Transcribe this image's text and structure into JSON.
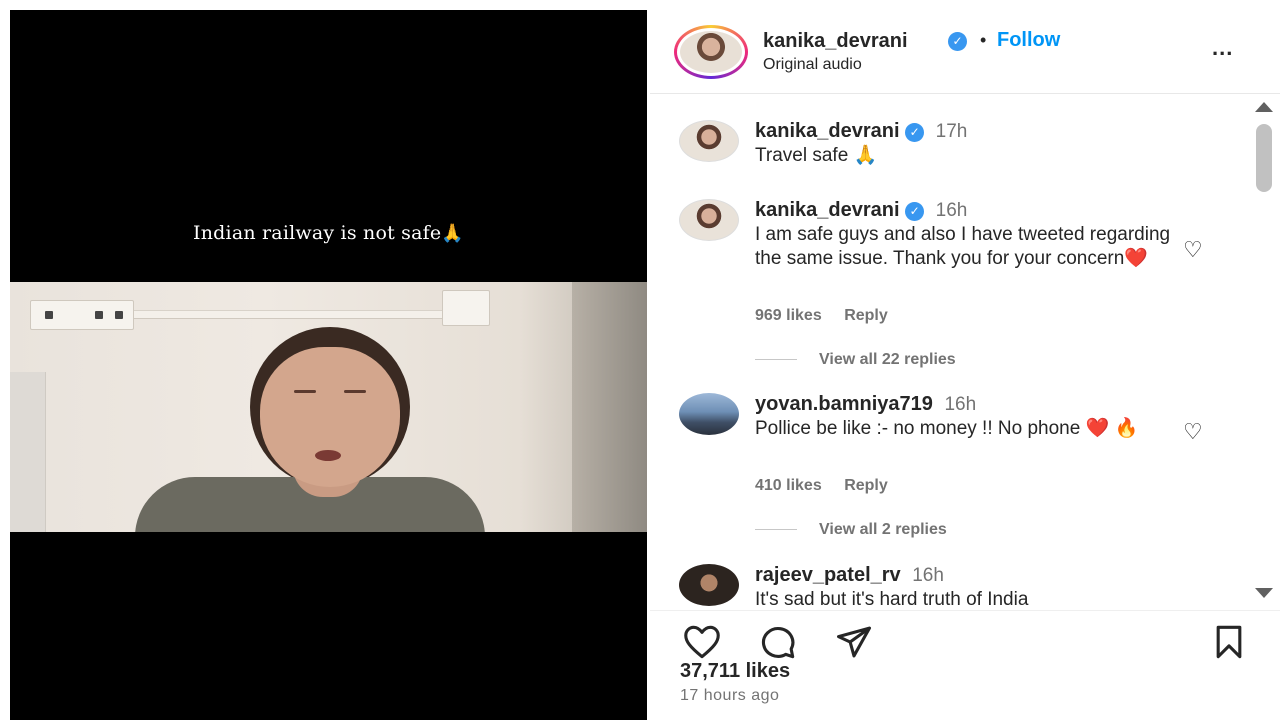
{
  "video": {
    "caption": "Indian railway is not safe",
    "caption_emoji": "🙏"
  },
  "header": {
    "username": "kanika_devrani",
    "verified_mark": "✓",
    "separator": "•",
    "follow_label": "Follow",
    "audio": "Original audio",
    "more_label": "..."
  },
  "comments": [
    {
      "username": "kanika_devrani",
      "time": "17h",
      "text": "Travel safe 🙏"
    },
    {
      "username": "kanika_devrani",
      "time": "16h",
      "text": "I am safe guys and also I have tweeted regarding the same issue. Thank you for your concern❤️",
      "likes": "969 likes",
      "reply_label": "Reply",
      "view_replies": "View all 22 replies"
    },
    {
      "username": "yovan.bamniya719",
      "time": "16h",
      "text": "Pollice be like :- no money !! No phone ❤️ 🔥",
      "likes": "410 likes",
      "reply_label": "Reply",
      "view_replies": "View all 2 replies"
    },
    {
      "username": "rajeev_patel_rv",
      "time": "16h",
      "text": "It's sad but it's hard truth of India"
    }
  ],
  "footer": {
    "likes": "37,711 likes",
    "posted": "17 hours ago"
  },
  "icons": {
    "heart": "heart-icon",
    "comment": "comment-icon",
    "share": "share-icon",
    "bookmark": "bookmark-icon"
  },
  "colors": {
    "follow": "#0095f6",
    "verified": "#3897f0",
    "video_bg": "#000000"
  }
}
